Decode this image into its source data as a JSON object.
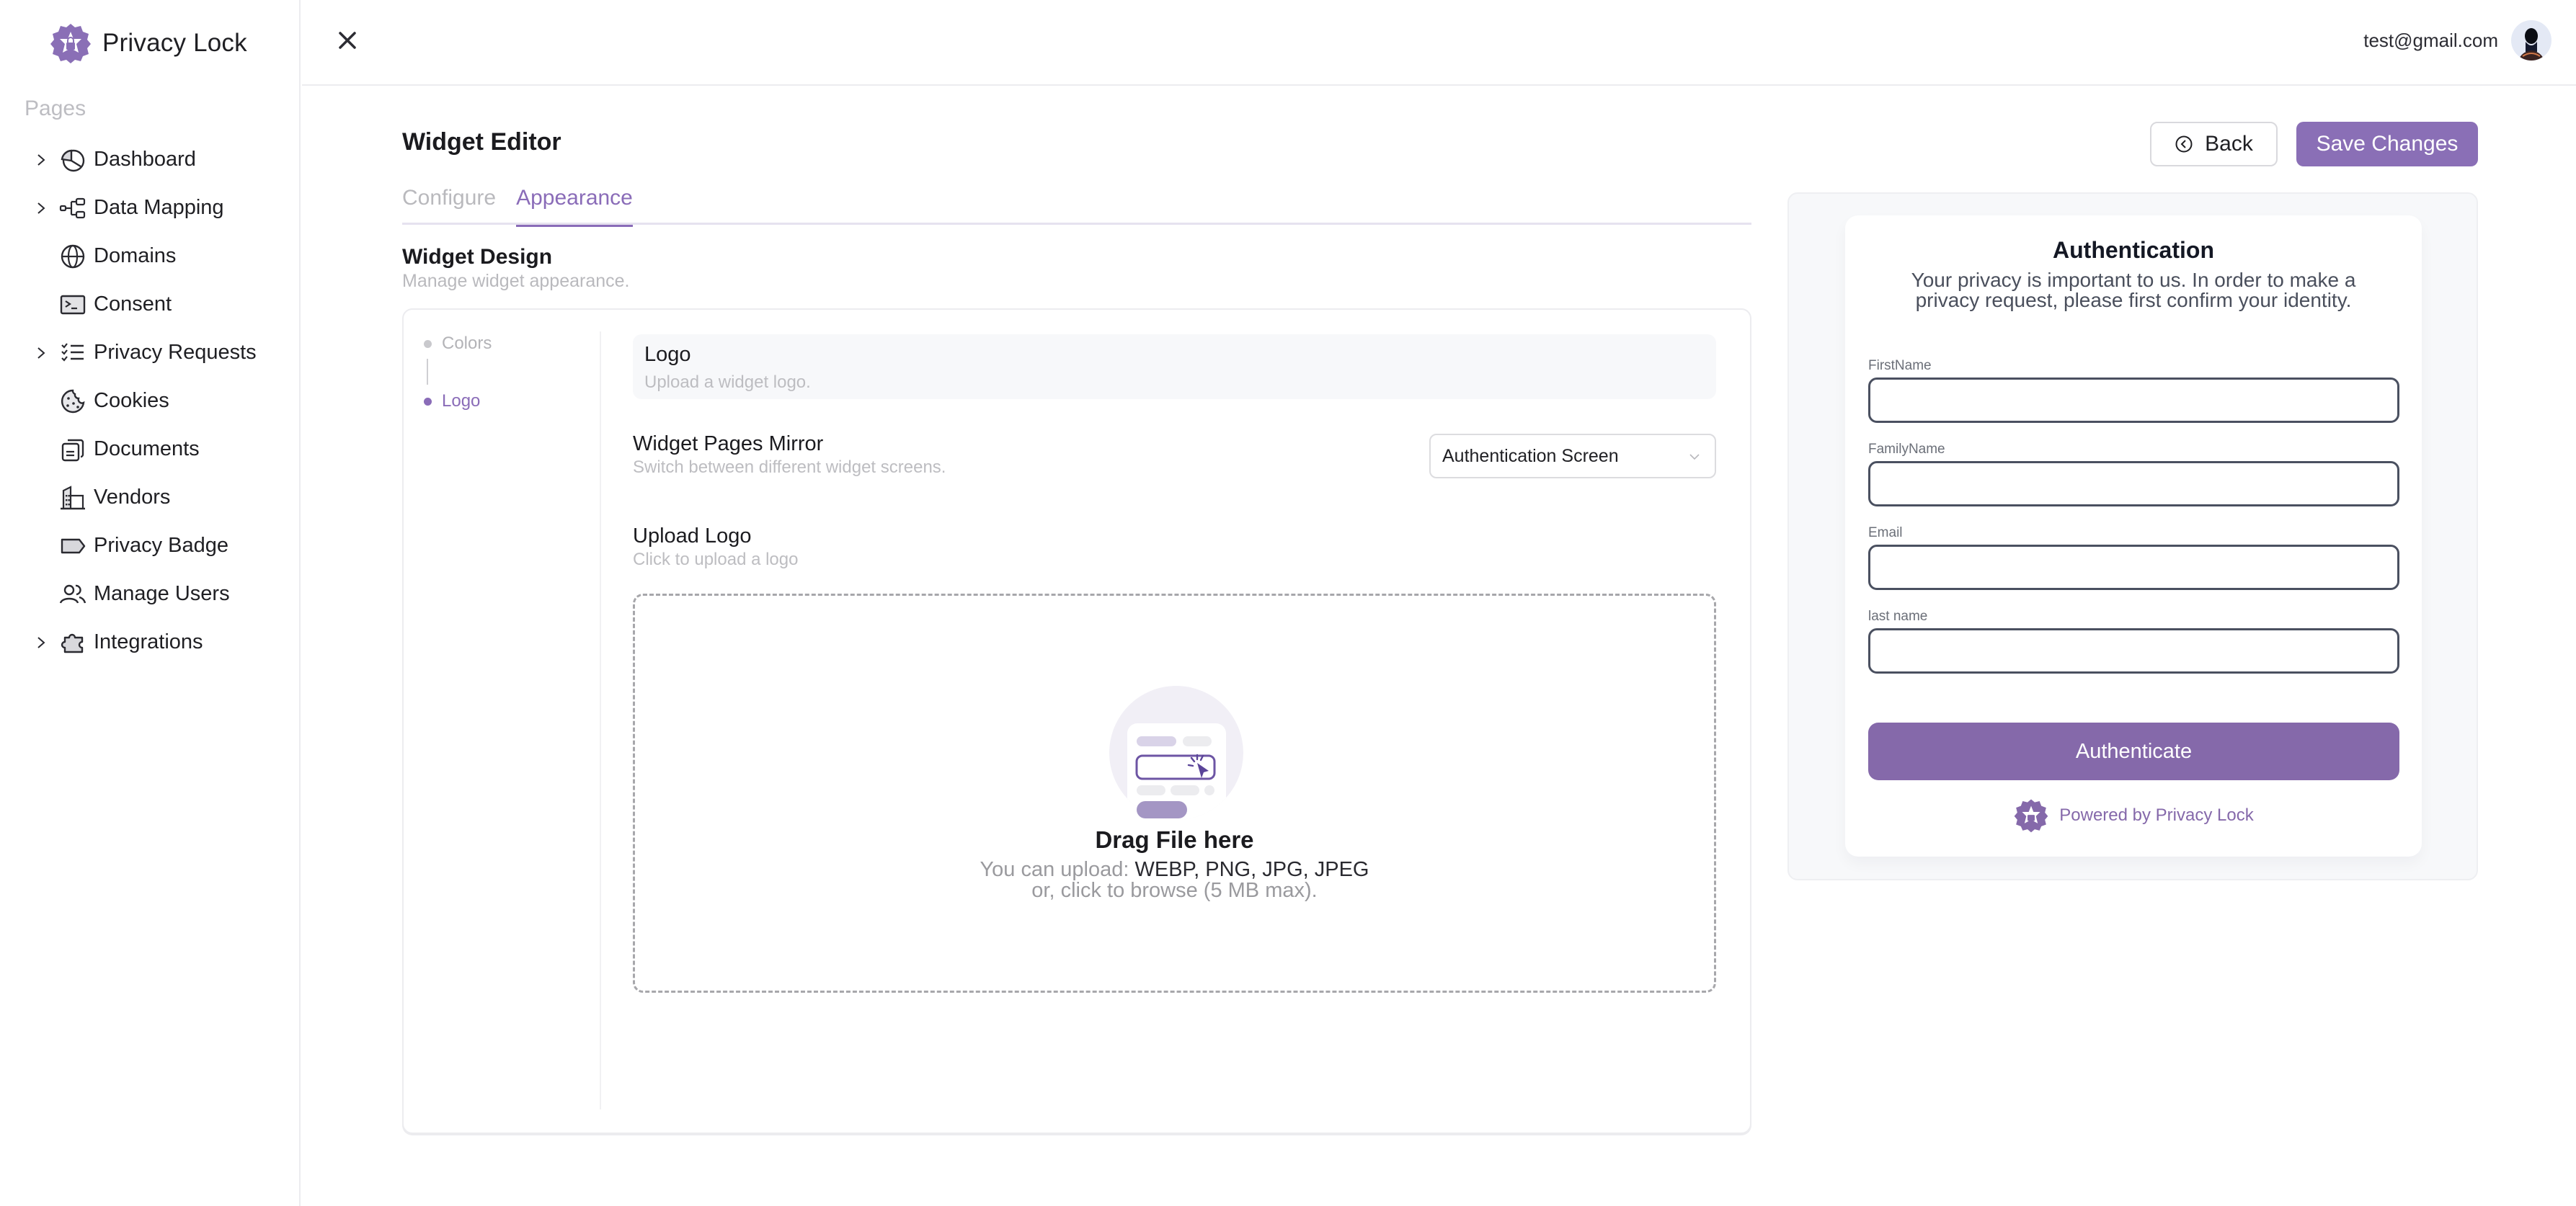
{
  "brand": {
    "name": "Privacy Lock",
    "icon": "privacy-lock-badge-icon",
    "accent_color": "#8a6fb6"
  },
  "sidebar": {
    "section_label": "Pages",
    "items": [
      {
        "label": "Dashboard",
        "icon": "pie-chart-icon",
        "expandable": true
      },
      {
        "label": "Data Mapping",
        "icon": "hierarchy-icon",
        "expandable": true
      },
      {
        "label": "Domains",
        "icon": "globe-icon",
        "expandable": false
      },
      {
        "label": "Consent",
        "icon": "terminal-window-icon",
        "expandable": false
      },
      {
        "label": "Privacy Requests",
        "icon": "checklist-icon",
        "expandable": true
      },
      {
        "label": "Cookies",
        "icon": "cookie-icon",
        "expandable": false
      },
      {
        "label": "Documents",
        "icon": "documents-icon",
        "expandable": false
      },
      {
        "label": "Vendors",
        "icon": "building-icon",
        "expandable": false
      },
      {
        "label": "Privacy Badge",
        "icon": "tag-icon",
        "expandable": false
      },
      {
        "label": "Manage Users",
        "icon": "users-icon",
        "expandable": false
      },
      {
        "label": "Integrations",
        "icon": "puzzle-icon",
        "expandable": true
      }
    ]
  },
  "header": {
    "close_icon": "close-icon",
    "user_email": "test@gmail.com"
  },
  "editor": {
    "title": "Widget Editor",
    "tabs": [
      {
        "label": "Configure",
        "active": false
      },
      {
        "label": "Appearance",
        "active": true
      }
    ],
    "back_label": "Back",
    "save_label": "Save Changes"
  },
  "design": {
    "title": "Widget Design",
    "subtitle": "Manage widget appearance.",
    "steps": [
      {
        "label": "Colors",
        "active": false
      },
      {
        "label": "Logo",
        "active": true
      }
    ],
    "logo_section": {
      "title": "Logo",
      "subtitle": "Upload a widget logo."
    },
    "pages_mirror": {
      "title": "Widget Pages Mirror",
      "subtitle": "Switch between different widget screens.",
      "selected": "Authentication Screen"
    },
    "upload": {
      "title": "Upload Logo",
      "subtitle": "Click to upload a logo",
      "drop_title": "Drag File here",
      "types_prefix": "You can upload: ",
      "types": "WEBP, PNG, JPG, JPEG",
      "browse_hint": "or, click to browse (5 MB max)."
    }
  },
  "preview": {
    "title": "Authentication",
    "description": "Your privacy is important to us. In order to make a privacy request, please first confirm your identity.",
    "fields": [
      {
        "label": "FirstName",
        "value": ""
      },
      {
        "label": "FamilyName",
        "value": ""
      },
      {
        "label": "Email",
        "value": ""
      },
      {
        "label": "last name",
        "value": ""
      }
    ],
    "button_label": "Authenticate",
    "powered_by": "Powered by Privacy Lock",
    "button_color": "#8569aa"
  }
}
